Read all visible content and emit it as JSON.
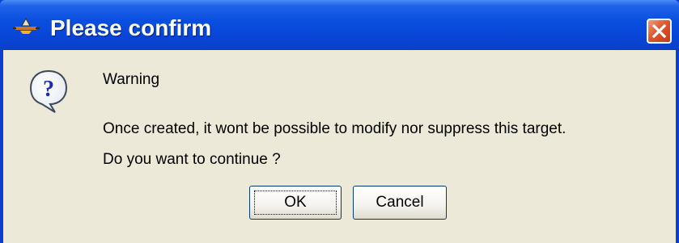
{
  "window": {
    "title": "Please confirm",
    "titlebar_color": "#0a4fe0",
    "close_button_color": "#e1562f",
    "app_icon": "java-cup-icon",
    "close_icon": "close-icon"
  },
  "message": {
    "icon": "question-icon",
    "heading": "Warning",
    "line1": "Once created, it wont be possible to modify nor suppress this target.",
    "line2": "Do you want to continue ?"
  },
  "buttons": {
    "ok_label": "OK",
    "cancel_label": "Cancel"
  }
}
